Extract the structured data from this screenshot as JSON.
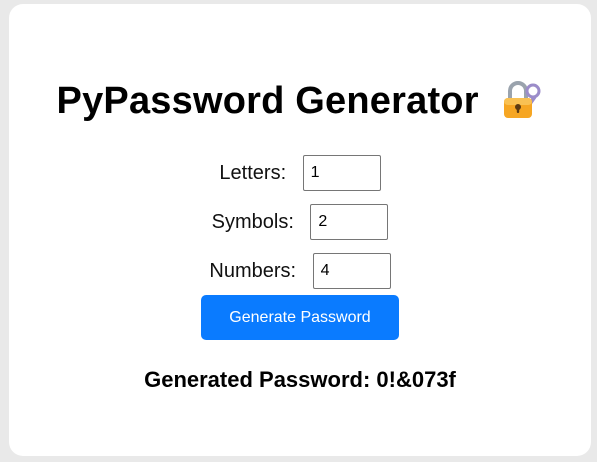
{
  "app": {
    "title": "PyPassword Generator",
    "title_icon": "lock-with-key-icon"
  },
  "form": {
    "letters": {
      "label": "Letters:",
      "value": "1"
    },
    "symbols": {
      "label": "Symbols:",
      "value": "2"
    },
    "numbers": {
      "label": "Numbers:",
      "value": "4"
    },
    "generate_button": "Generate Password"
  },
  "result": {
    "label": "Generated Password:",
    "value": "0!&073f"
  },
  "colors": {
    "button_bg": "#0a7bff",
    "page_bg": "#e9e9e9",
    "card_bg": "#ffffff"
  }
}
